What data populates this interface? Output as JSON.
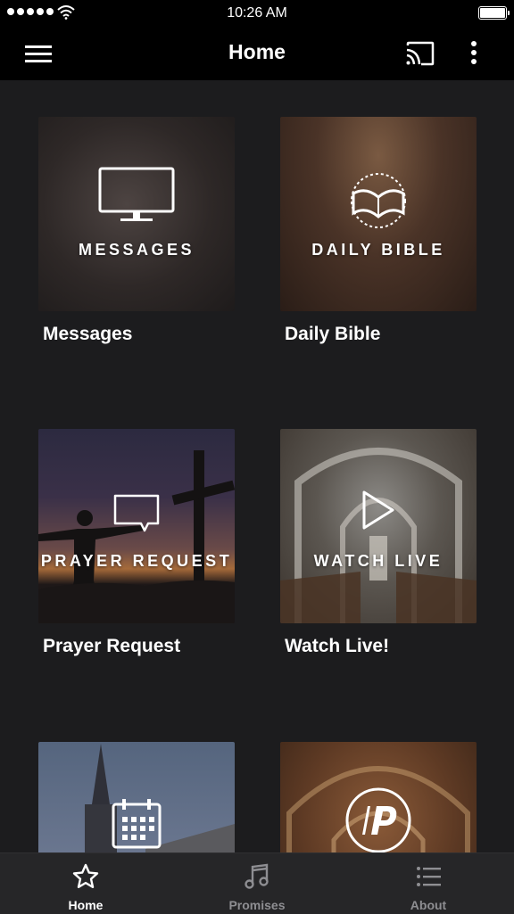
{
  "status_bar": {
    "time": "10:26 AM"
  },
  "header": {
    "title": "Home"
  },
  "tiles": [
    {
      "caption": "MESSAGES",
      "label": "Messages",
      "icon": "monitor-icon"
    },
    {
      "caption": "DAILY BIBLE",
      "label": "Daily Bible",
      "icon": "open-book-icon"
    },
    {
      "caption": "PRAYER REQUEST",
      "label": "Prayer Request",
      "icon": "speech-bubble-icon"
    },
    {
      "caption": "WATCH LIVE",
      "label": "Watch Live!",
      "icon": "play-icon"
    },
    {
      "caption": "",
      "label": "",
      "icon": "calendar-icon"
    },
    {
      "caption": "",
      "label": "",
      "icon": "podcast-p-icon"
    }
  ],
  "tab_bar": {
    "tabs": [
      {
        "label": "Home",
        "icon": "star-icon",
        "active": true
      },
      {
        "label": "Promises",
        "icon": "music-note-icon",
        "active": false
      },
      {
        "label": "About",
        "icon": "list-icon",
        "active": false
      }
    ]
  },
  "colors": {
    "background": "#1c1c1e",
    "bars": "#000000",
    "tab_bar": "#262628",
    "inactive_tab": "#8e8e92"
  }
}
